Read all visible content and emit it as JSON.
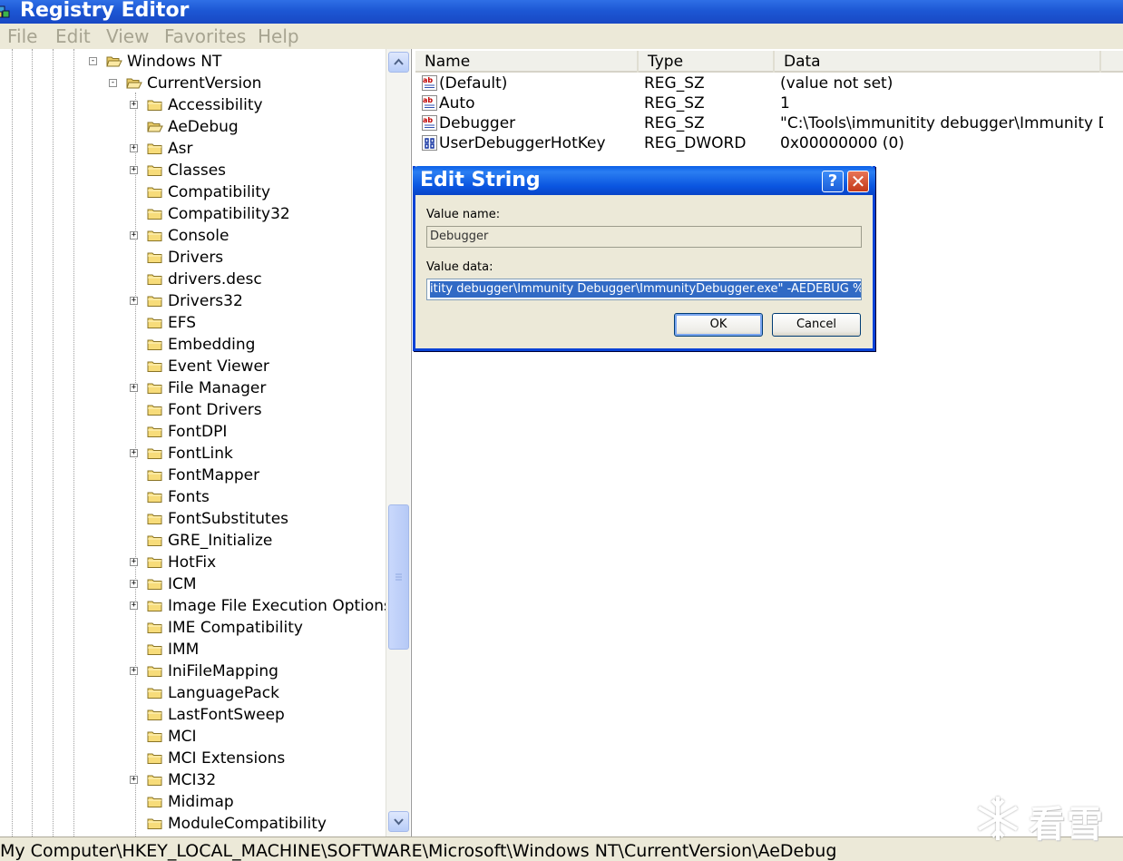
{
  "window": {
    "title": "Registry Editor"
  },
  "menu": [
    "File",
    "Edit",
    "View",
    "Favorites",
    "Help"
  ],
  "tree": {
    "parents": [
      {
        "label": "Windows NT",
        "expander": "-"
      },
      {
        "label": "CurrentVersion",
        "expander": "-"
      }
    ],
    "children": [
      {
        "label": "Accessibility",
        "expander": "+"
      },
      {
        "label": "AeDebug",
        "expander": "",
        "selected": true
      },
      {
        "label": "Asr",
        "expander": "+"
      },
      {
        "label": "Classes",
        "expander": "+"
      },
      {
        "label": "Compatibility",
        "expander": ""
      },
      {
        "label": "Compatibility32",
        "expander": ""
      },
      {
        "label": "Console",
        "expander": "+"
      },
      {
        "label": "Drivers",
        "expander": ""
      },
      {
        "label": "drivers.desc",
        "expander": ""
      },
      {
        "label": "Drivers32",
        "expander": "+"
      },
      {
        "label": "EFS",
        "expander": ""
      },
      {
        "label": "Embedding",
        "expander": ""
      },
      {
        "label": "Event Viewer",
        "expander": ""
      },
      {
        "label": "File Manager",
        "expander": "+"
      },
      {
        "label": "Font Drivers",
        "expander": ""
      },
      {
        "label": "FontDPI",
        "expander": ""
      },
      {
        "label": "FontLink",
        "expander": "+"
      },
      {
        "label": "FontMapper",
        "expander": ""
      },
      {
        "label": "Fonts",
        "expander": ""
      },
      {
        "label": "FontSubstitutes",
        "expander": ""
      },
      {
        "label": "GRE_Initialize",
        "expander": ""
      },
      {
        "label": "HotFix",
        "expander": "+"
      },
      {
        "label": "ICM",
        "expander": "+"
      },
      {
        "label": "Image File Execution Options",
        "expander": "+"
      },
      {
        "label": "IME Compatibility",
        "expander": ""
      },
      {
        "label": "IMM",
        "expander": ""
      },
      {
        "label": "IniFileMapping",
        "expander": "+"
      },
      {
        "label": "LanguagePack",
        "expander": ""
      },
      {
        "label": "LastFontSweep",
        "expander": ""
      },
      {
        "label": "MCI",
        "expander": ""
      },
      {
        "label": "MCI Extensions",
        "expander": ""
      },
      {
        "label": "MCI32",
        "expander": "+"
      },
      {
        "label": "Midimap",
        "expander": ""
      },
      {
        "label": "ModuleCompatibility",
        "expander": ""
      }
    ]
  },
  "list": {
    "columns": [
      "Name",
      "Type",
      "Data"
    ],
    "rows": [
      {
        "icon": "string-value-icon",
        "name": "(Default)",
        "type": "REG_SZ",
        "data": "(value not set)"
      },
      {
        "icon": "string-value-icon",
        "name": "Auto",
        "type": "REG_SZ",
        "data": "1"
      },
      {
        "icon": "string-value-icon",
        "name": "Debugger",
        "type": "REG_SZ",
        "data": "\"C:\\Tools\\immunitity debugger\\Immunity De..."
      },
      {
        "icon": "dword-value-icon",
        "name": "UserDebuggerHotKey",
        "type": "REG_DWORD",
        "data": "0x00000000 (0)"
      }
    ]
  },
  "dialog": {
    "title": "Edit String",
    "help": "?",
    "close": "✕",
    "value_name_label": "Value name:",
    "value_name": "Debugger",
    "value_data_label": "Value data:",
    "value_data": "itity debugger\\Immunity Debugger\\ImmunityDebugger.exe\" -AEDEBUG %ld %ld",
    "ok": "OK",
    "cancel": "Cancel"
  },
  "status": {
    "path": "My Computer\\HKEY_LOCAL_MACHINE\\SOFTWARE\\Microsoft\\Windows NT\\CurrentVersion\\AeDebug"
  },
  "watermark": {
    "text": "看雪"
  },
  "colors": {
    "titlebar": "#1d57d4",
    "dialog_title": "#0a55e0",
    "selection": "#316ac5",
    "chrome": "#ece9d8"
  }
}
